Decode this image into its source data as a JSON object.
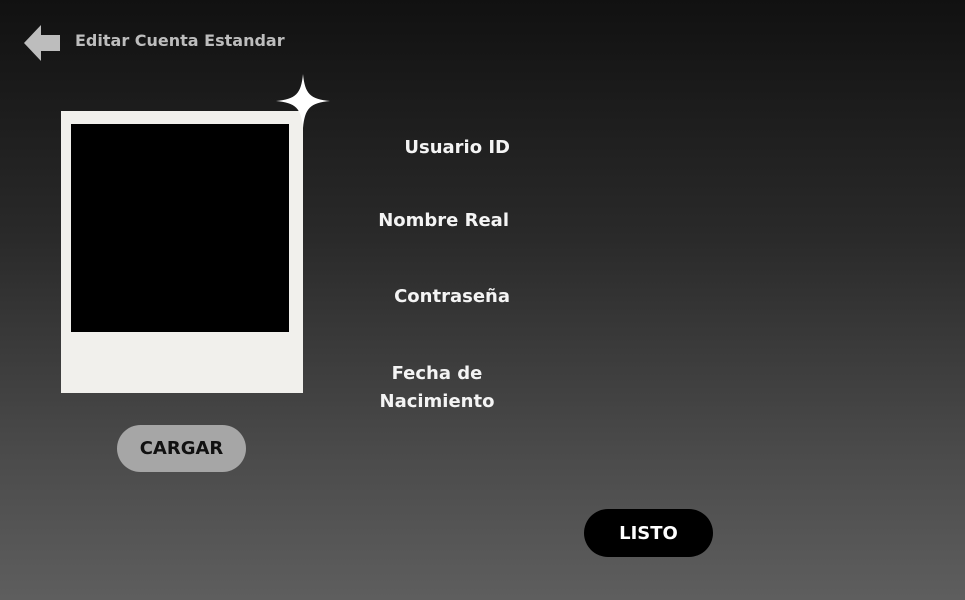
{
  "header": {
    "title": "Editar Cuenta Estandar",
    "back_icon": "arrow-left-icon"
  },
  "profile": {
    "upload_label": "CARGAR",
    "sparkle_icon": "sparkle-icon"
  },
  "form": {
    "usuario_label": "Usuario ID",
    "nombre_label": "Nombre Real",
    "password_label": "Contraseña",
    "fecha_label_line1": "Fecha de",
    "fecha_label_line2": "Nacimiento"
  },
  "actions": {
    "done_label": "LISTO"
  },
  "colors": {
    "background_top": "#111111",
    "background_bottom": "#5e5e5e",
    "polaroid": "#f1f0ec",
    "upload_button": "#a6a6a6",
    "done_button": "#000000"
  }
}
